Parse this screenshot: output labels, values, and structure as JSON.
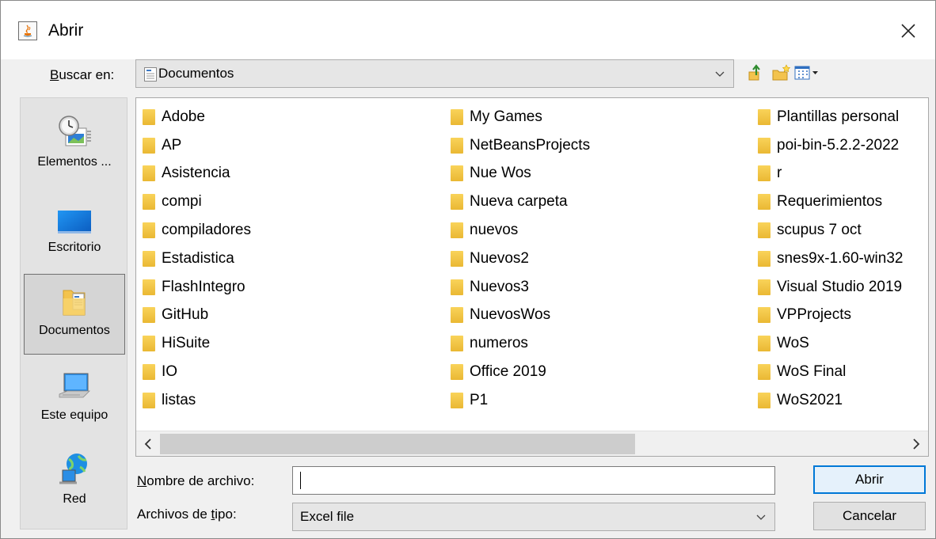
{
  "window": {
    "title": "Abrir",
    "title_icon": "java-icon",
    "close_icon": "close-icon"
  },
  "lookin": {
    "label_accesskey": "B",
    "label_rest": "uscar en:",
    "value": "Documentos",
    "value_icon": "documents-icon"
  },
  "toolbar": {
    "icons": [
      "up-folder-icon",
      "new-folder-icon",
      "view-menu-icon"
    ]
  },
  "places": [
    {
      "label": "Elementos ...",
      "icon": "recent-items-icon",
      "selected": false
    },
    {
      "label": "Escritorio",
      "icon": "desktop-icon",
      "selected": false
    },
    {
      "label": "Documentos",
      "icon": "documents-icon",
      "selected": true
    },
    {
      "label": "Este equipo",
      "icon": "computer-icon",
      "selected": false
    },
    {
      "label": "Red",
      "icon": "network-icon",
      "selected": false
    }
  ],
  "files": {
    "col1": [
      "Adobe",
      "AP",
      "Asistencia",
      "compi",
      "compiladores",
      "Estadistica",
      "FlashIntegro",
      "GitHub",
      "HiSuite",
      "IO",
      "listas"
    ],
    "col2": [
      "My Games",
      "NetBeansProjects",
      "Nue Wos",
      "Nueva carpeta",
      "nuevos",
      "Nuevos2",
      "Nuevos3",
      "NuevosWos",
      "numeros",
      "Office 2019",
      "P1"
    ],
    "col3": [
      "Plantillas personal",
      "poi-bin-5.2.2-2022",
      "r",
      "Requerimientos",
      "scupus 7 oct",
      "snes9x-1.60-win32",
      "Visual Studio 2019",
      "VPProjects",
      "WoS",
      "WoS Final",
      "WoS2021"
    ]
  },
  "filename": {
    "label_accesskey": "N",
    "label_rest": "ombre de archivo:",
    "value": ""
  },
  "filetype": {
    "label_pre": "Archivos de ",
    "label_accesskey": "t",
    "label_post": "ipo:",
    "value": "Excel file"
  },
  "buttons": {
    "open": "Abrir",
    "cancel": "Cancelar"
  },
  "colors": {
    "accent": "#0078d7",
    "folder": "#eab833"
  }
}
